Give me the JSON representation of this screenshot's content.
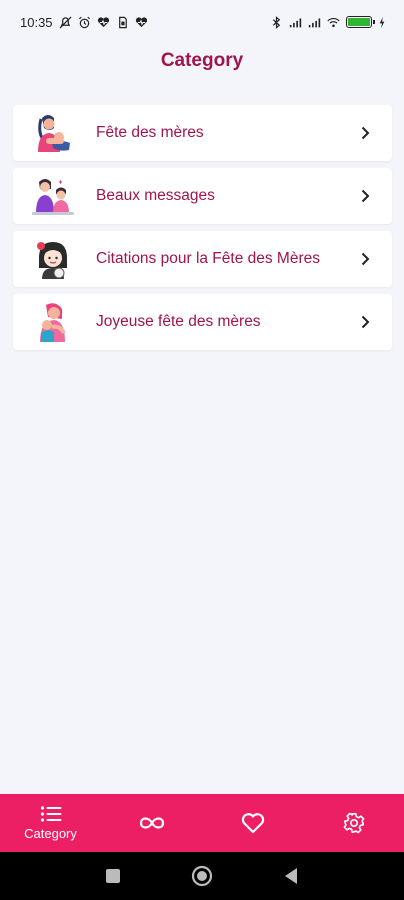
{
  "status_bar": {
    "time": "10:35",
    "left_icons": [
      "notifications-off-icon",
      "alarm-icon",
      "heart-pulse-icon",
      "sim-icon",
      "heart-pulse-icon"
    ],
    "right_icons": [
      "bluetooth-icon",
      "signal-icon",
      "signal-icon",
      "wifi-icon",
      "battery-icon",
      "charging-icon"
    ],
    "battery_color": "#2fb52f"
  },
  "header": {
    "title": "Category"
  },
  "categories": [
    {
      "label": "Fête des mères",
      "thumb": "mother-baby-icon"
    },
    {
      "label": "Beaux messages",
      "thumb": "mother-child-icon"
    },
    {
      "label": "Citations pour la Fête des Mères",
      "thumb": "girl-with-flower-icon"
    },
    {
      "label": "Joyeuse fête des mères",
      "thumb": "mother-hug-icon"
    }
  ],
  "bottom_nav": {
    "items": [
      {
        "label": "Category",
        "icon": "list-icon"
      },
      {
        "label": "",
        "icon": "infinity-icon"
      },
      {
        "label": "",
        "icon": "heart-icon"
      },
      {
        "label": "",
        "icon": "gear-icon"
      }
    ],
    "background": "#ec1e64"
  },
  "colors": {
    "accent": "#a0154e",
    "background": "#f4f5fa"
  }
}
